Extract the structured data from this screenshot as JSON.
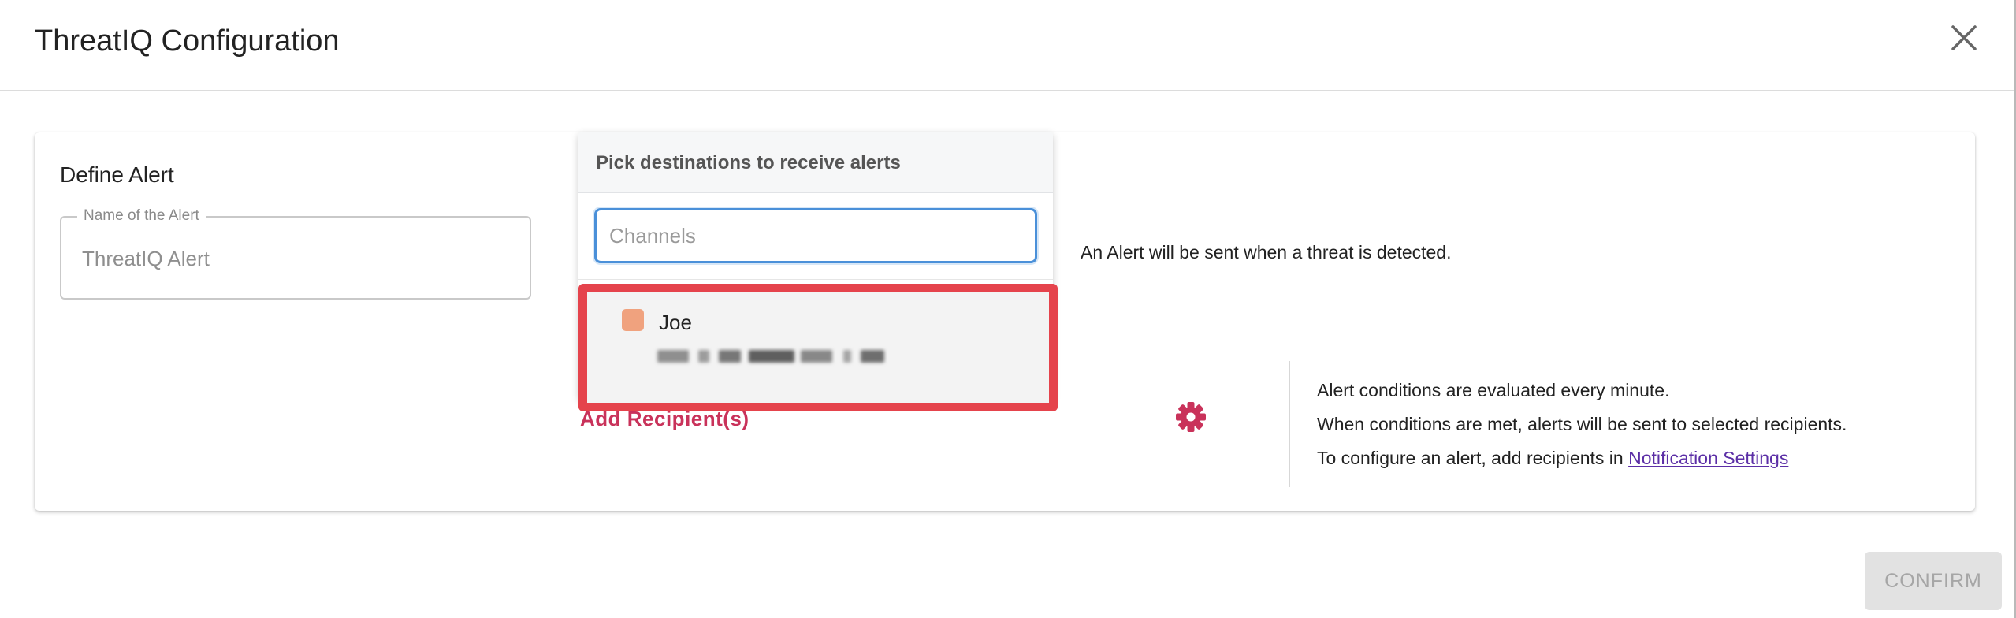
{
  "dialog": {
    "title": "ThreatIQ Configuration",
    "confirm_label": "CONFIRM"
  },
  "define_alert": {
    "section_title": "Define Alert",
    "name_label": "Name of the Alert",
    "name_placeholder": "ThreatIQ Alert"
  },
  "destinations": {
    "header": "Pick destinations to receive alerts",
    "search_placeholder": "Channels",
    "options": [
      {
        "name": "Joe",
        "checkbox_color": "#f0a27e",
        "checked": false
      }
    ],
    "add_recipients_label": "Add Recipient(s)"
  },
  "alert_note": "An Alert will be sent when a threat is detected.",
  "info": {
    "lines": [
      "Alert conditions are evaluated every minute.",
      "When conditions are met, alerts will be sent to selected recipients.",
      "To configure an alert, add recipients in"
    ],
    "link_text": "Notification Settings"
  },
  "colors": {
    "accent": "#c9325a",
    "highlight": "#e5434c",
    "focus": "#4a90d9",
    "link": "#5b2ea6"
  },
  "icons": {
    "close": "close-icon",
    "settings": "gear-icon"
  }
}
